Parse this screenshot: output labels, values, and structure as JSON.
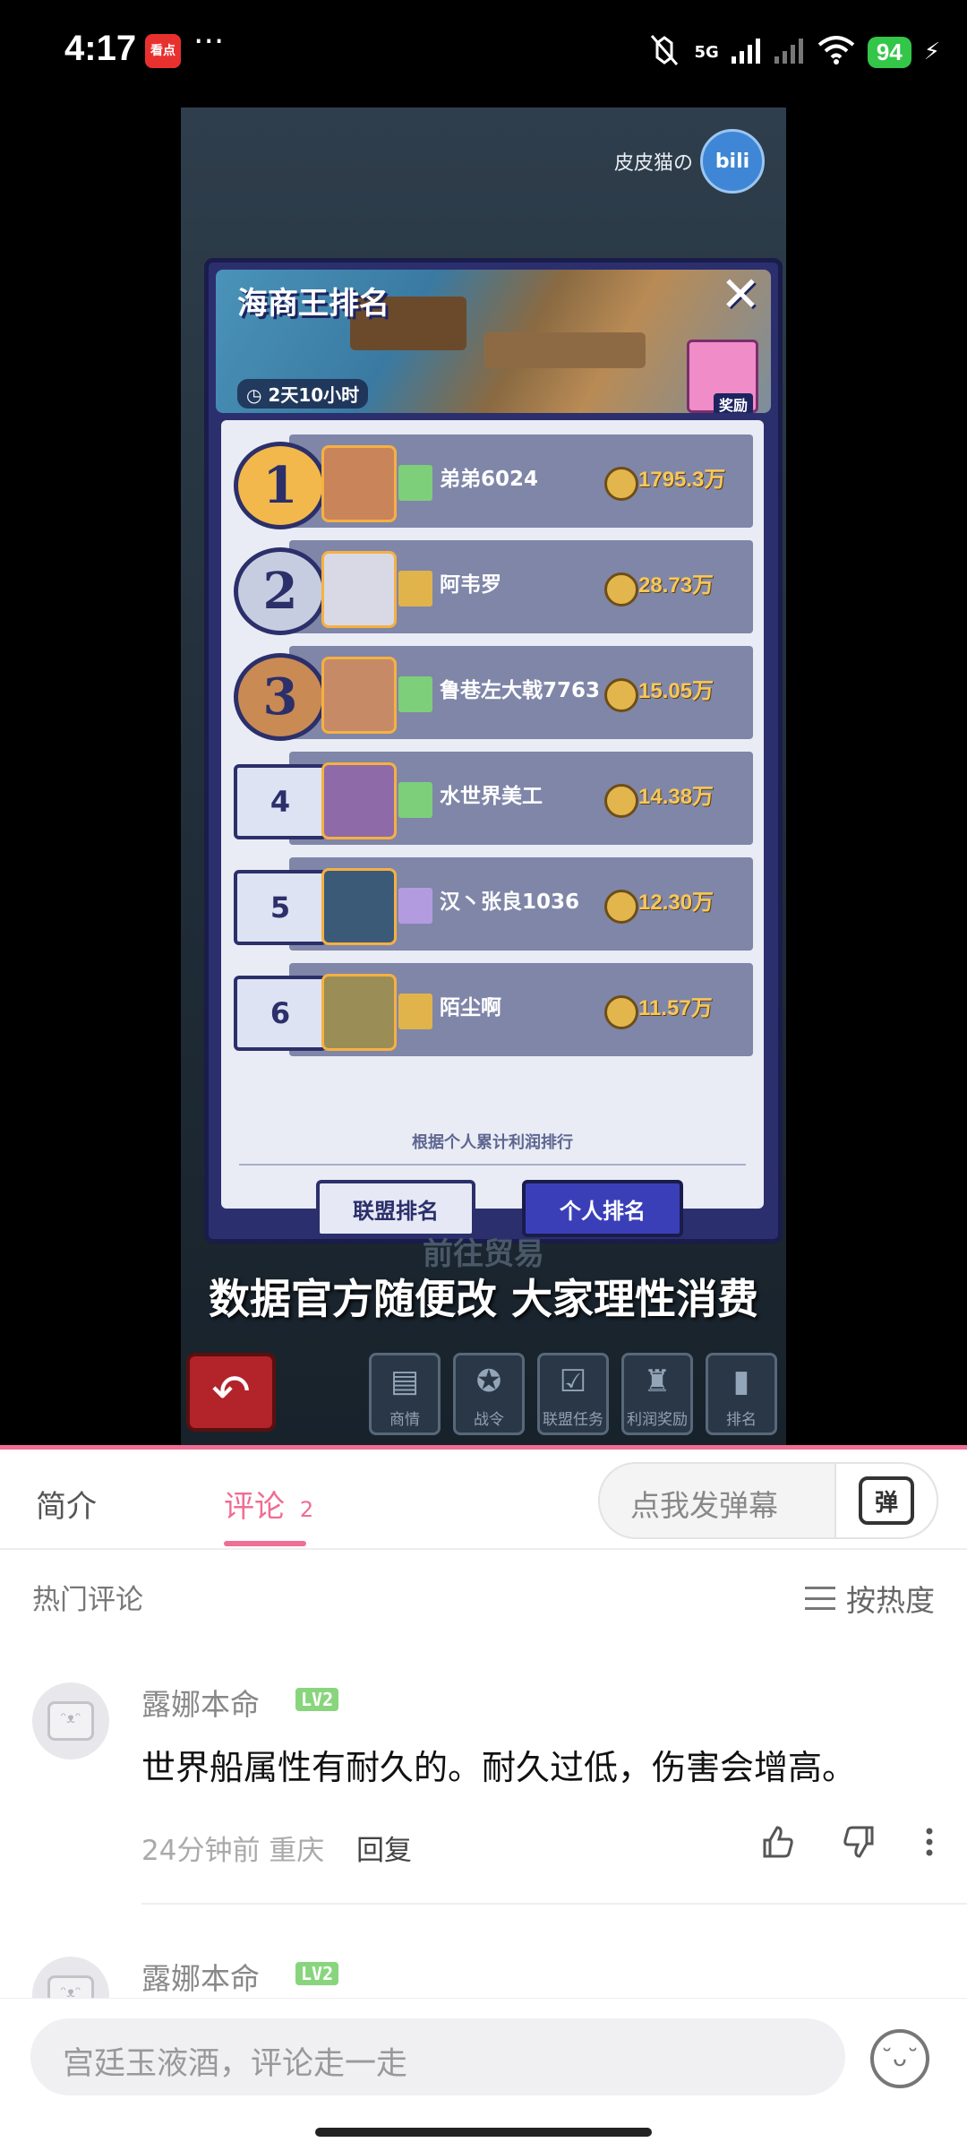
{
  "status": {
    "time": "4:17",
    "app_badge": "看点",
    "network": "5G",
    "battery": "94",
    "dots": "···"
  },
  "video": {
    "watermark_text": "皮皮猫の",
    "watermark_logo": "bili",
    "panel": {
      "title": "海商王排名",
      "timer": "2天10小时",
      "reward_label": "奖励",
      "close": "✕",
      "rows": [
        {
          "rank": "1",
          "name": "弟弟6024",
          "score": "1795.3万",
          "medal_color": "#f2b84b",
          "flag_color": "#7dcf7a",
          "avatar_color": "#c9845a"
        },
        {
          "rank": "2",
          "name": "阿韦罗",
          "score": "28.73万",
          "medal_color": "#c7cde0",
          "flag_color": "#e0b44a",
          "avatar_color": "#d9d9e6"
        },
        {
          "rank": "3",
          "name": "鲁巷左大戟7763",
          "score": "15.05万",
          "medal_color": "#c98a54",
          "flag_color": "#7dcf7a",
          "avatar_color": "#c78a66"
        },
        {
          "rank": "4",
          "name": "水世界美工",
          "score": "14.38万",
          "medal_color": "",
          "flag_color": "#7dcf7a",
          "avatar_color": "#8e6aa8"
        },
        {
          "rank": "5",
          "name": "汉丶张良1036",
          "score": "12.30万",
          "medal_color": "",
          "flag_color": "#b39be0",
          "avatar_color": "#3a5a78"
        },
        {
          "rank": "6",
          "name": "陌尘啊",
          "score": "11.57万",
          "medal_color": "",
          "flag_color": "#e0b44a",
          "avatar_color": "#9a8d55"
        }
      ],
      "note": "根据个人累计利润排行",
      "btn_alliance": "联盟排名",
      "btn_personal": "个人排名"
    },
    "under_text": "前往贸易",
    "subtitle": "数据官方随便改 大家理性消费",
    "back_icon": "↶",
    "game_nav": [
      {
        "label": "商情",
        "icon": "▤"
      },
      {
        "label": "战令",
        "icon": "✪"
      },
      {
        "label": "联盟任务",
        "icon": "☑"
      },
      {
        "label": "利润奖励",
        "icon": "♜"
      },
      {
        "label": "排名",
        "icon": "▮"
      }
    ]
  },
  "tabs": {
    "intro": "简介",
    "comments": "评论",
    "comments_count": "2",
    "danmaku_placeholder": "点我发弹幕",
    "danmaku_icon": "弹"
  },
  "comments": {
    "hot_label": "热门评论",
    "sort_label": "按热度",
    "items": [
      {
        "user": "露娜本命",
        "level": "LV2",
        "text": "世界船属性有耐久的。耐久过低，伤害会增高。",
        "meta": "24分钟前 重庆",
        "reply": "回复"
      },
      {
        "user": "露娜本命",
        "level": "LV2"
      }
    ]
  },
  "bottom": {
    "placeholder": "宫廷玉液酒，评论走一走",
    "emoji": "˘ᴗ˘"
  },
  "colors": {
    "accent": "#f06d94",
    "panel_dark": "#2c2f6e",
    "row_bar": "#7f86a8",
    "score_gold": "#f7c75b"
  }
}
